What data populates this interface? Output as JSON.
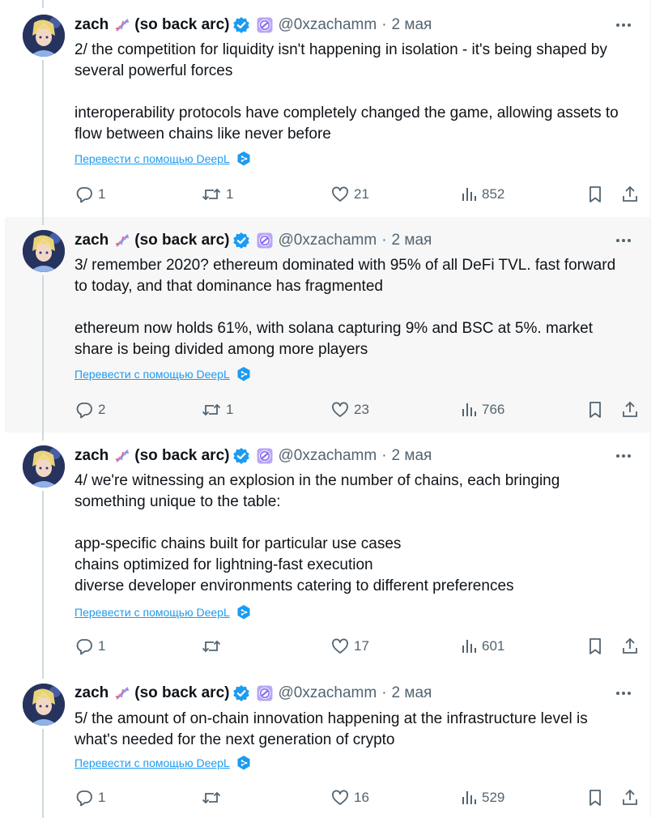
{
  "author": {
    "name": "zach",
    "name_suffix": "(so back arc)",
    "handle": "@0xzachamm",
    "date": "2 мая"
  },
  "translate_label": "Перевести с помощью DeepL",
  "colors": {
    "accent": "#1d9bf0",
    "muted": "#536471",
    "thread_line": "#cfd9de",
    "highlight_bg": "#f7f7f7"
  },
  "icons": [
    "dna-icon",
    "verified-badge-icon",
    "affiliate-badge-icon",
    "more-icon",
    "reply-icon",
    "retweet-icon",
    "like-icon",
    "views-icon",
    "bookmark-icon",
    "share-icon",
    "deepl-icon"
  ],
  "tweets": [
    {
      "paragraphs": [
        "2/ the competition for liquidity isn't happening in isolation - it's being shaped by several powerful forces",
        "",
        "interoperability protocols have completely changed the game, allowing assets to flow between chains like never before"
      ],
      "replies": "1",
      "retweets": "1",
      "likes": "21",
      "views": "852"
    },
    {
      "paragraphs": [
        "3/ remember 2020? ethereum dominated with 95% of all DeFi TVL. fast forward to today, and that dominance has fragmented",
        "",
        "ethereum now holds 61%, with solana capturing 9% and BSC at 5%. market share is being divided among more players"
      ],
      "replies": "2",
      "retweets": "1",
      "likes": "23",
      "views": "766"
    },
    {
      "paragraphs": [
        "4/ we're witnessing an explosion in the number of chains, each bringing something unique to the table:",
        "",
        "app-specific chains built for particular use cases",
        "chains optimized for lightning-fast execution",
        "diverse developer environments catering to different preferences"
      ],
      "replies": "1",
      "retweets": "",
      "likes": "17",
      "views": "601"
    },
    {
      "paragraphs": [
        "5/ the amount of on-chain innovation happening at the infrastructure level is what's needed for the next generation of crypto"
      ],
      "replies": "1",
      "retweets": "",
      "likes": "16",
      "views": "529"
    }
  ]
}
